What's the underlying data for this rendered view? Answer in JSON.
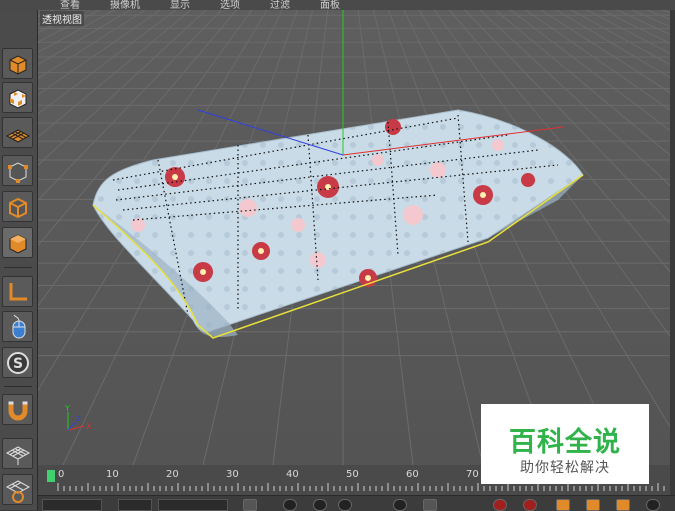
{
  "menu": {
    "items": [
      "查看",
      "摄像机",
      "显示",
      "选项",
      "过滤",
      "面板"
    ]
  },
  "viewport": {
    "label": "透视视图"
  },
  "toolbar": {
    "icons": [
      "cube-icon",
      "checker-cube-icon",
      "grid-plane-icon",
      "points-mode-icon",
      "edges-mode-icon",
      "polygons-mode-icon",
      "axis-icon",
      "mouse-icon",
      "snap-s-icon",
      "magnet-icon",
      "lattice-icon",
      "loop-icon"
    ]
  },
  "axes": {
    "x": "X",
    "y": "Y",
    "z": "Z"
  },
  "timeline": {
    "ticks": [
      "0",
      "10",
      "20",
      "30",
      "40",
      "50",
      "60",
      "70"
    ]
  },
  "watermark": {
    "title": "百科全说",
    "subtitle": "助你轻松解决"
  },
  "colors": {
    "viewport_bg": "#5b5b5b",
    "active_frame": "#3fd06f",
    "watermark_green": "#2fb34a",
    "y_axis": "#22cc22",
    "x_axis": "#e03030",
    "z_axis": "#3040e0"
  }
}
